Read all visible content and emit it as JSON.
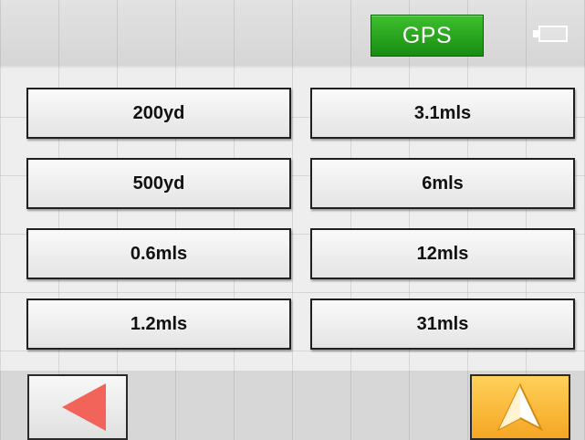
{
  "header": {
    "gps_label": "GPS",
    "battery_icon": "battery-icon"
  },
  "scale_options": {
    "left": [
      "200yd",
      "500yd",
      "0.6mls",
      "1.2mls"
    ],
    "right": [
      "3.1mls",
      "6mls",
      "12mls",
      "31mls"
    ]
  },
  "footer": {
    "back_icon": "back-arrow-icon",
    "navigate_icon": "navigation-arrow-icon"
  },
  "colors": {
    "gps_green": "#1f9a17",
    "back_arrow": "#f2645a",
    "nav_button": "#f7b02f"
  }
}
